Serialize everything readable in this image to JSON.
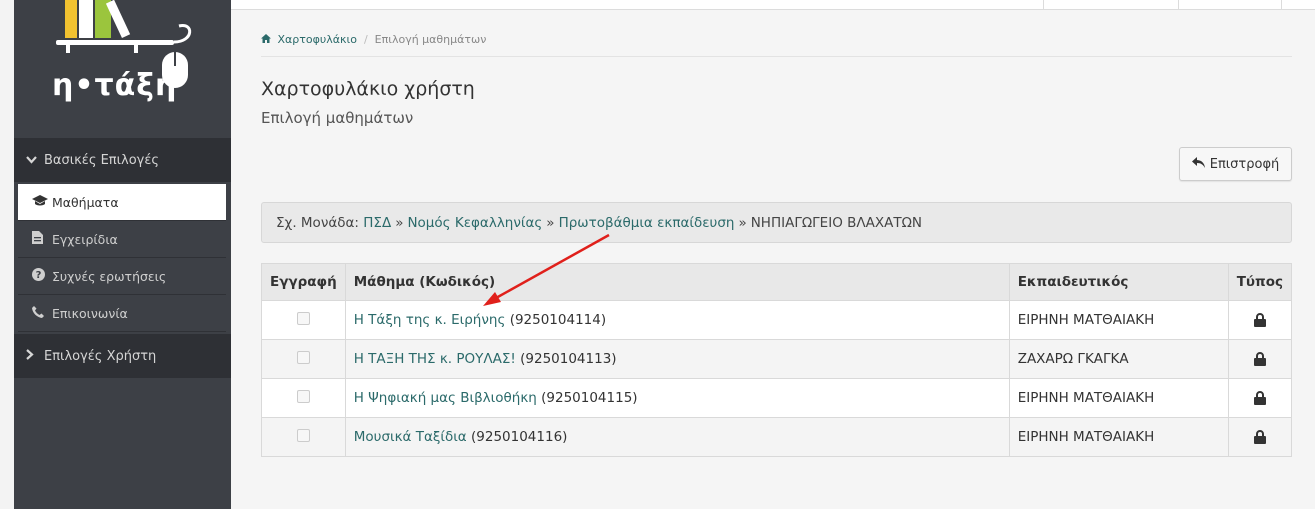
{
  "logo": {
    "text": "η•τάξη",
    "icon": "bookshelf-mouse-logo"
  },
  "sidebar": {
    "section_main": {
      "label": "Βασικές Επιλογές",
      "icon": "chevron-down-icon"
    },
    "items": [
      {
        "label": "Μαθήματα",
        "icon": "graduation-cap-icon",
        "active": true
      },
      {
        "label": "Εγχειρίδια",
        "icon": "document-icon"
      },
      {
        "label": "Συχνές ερωτήσεις",
        "icon": "question-circle-icon"
      },
      {
        "label": "Επικοινωνία",
        "icon": "phone-icon"
      }
    ],
    "section_user": {
      "label": "Επιλογές Χρήστη",
      "icon": "chevron-right-icon"
    }
  },
  "breadcrumb": {
    "home": "Χαρτοφυλάκιο",
    "current": "Επιλογή μαθημάτων"
  },
  "page": {
    "title": "Χαρτοφυλάκιο χρήστη",
    "subtitle": "Επιλογή μαθημάτων"
  },
  "back_button": {
    "label": "Επιστροφή",
    "icon": "reply-arrow-icon"
  },
  "unit": {
    "prefix": "Σχ. Μονάδα:",
    "links": [
      "ΠΣΔ",
      "Νομός Κεφαλληνίας",
      "Πρωτοβάθμια εκπαίδευση"
    ],
    "separator": "»",
    "school": "ΝΗΠΙΑΓΩΓΕΙΟ ΒΛΑΧΑΤΩΝ"
  },
  "table": {
    "headers": {
      "register": "Εγγραφή",
      "course": "Μάθημα (Κωδικός)",
      "teacher": "Εκπαιδευτικός",
      "type": "Τύπος"
    },
    "rows": [
      {
        "course": "Η Τάξη της κ. Ειρήνης",
        "code": "(9250104114)",
        "teacher": "ΕΙΡΗΝΗ ΜΑΤΘΑΙΑΚΗ",
        "type_icon": "lock-icon"
      },
      {
        "course": "Η ΤΑΞΗ ΤΗΣ κ. ΡΟΥΛΑΣ!",
        "code": "(9250104113)",
        "teacher": "ΖΑΧΑΡΩ ΓΚΑΓΚΑ",
        "type_icon": "lock-icon"
      },
      {
        "course": "Η Ψηφιακή μας Βιβλιοθήκη",
        "code": "(9250104115)",
        "teacher": "ΕΙΡΗΝΗ ΜΑΤΘΑΙΑΚΗ",
        "type_icon": "lock-icon"
      },
      {
        "course": "Μουσικά Ταξίδια",
        "code": "(9250104116)",
        "teacher": "ΕΙΡΗΝΗ ΜΑΤΘΑΙΑΚΗ",
        "type_icon": "lock-icon"
      }
    ]
  },
  "colors": {
    "sidebar": "#3d4046",
    "link": "#2b6a6a",
    "annotation_arrow": "#e0201b"
  }
}
